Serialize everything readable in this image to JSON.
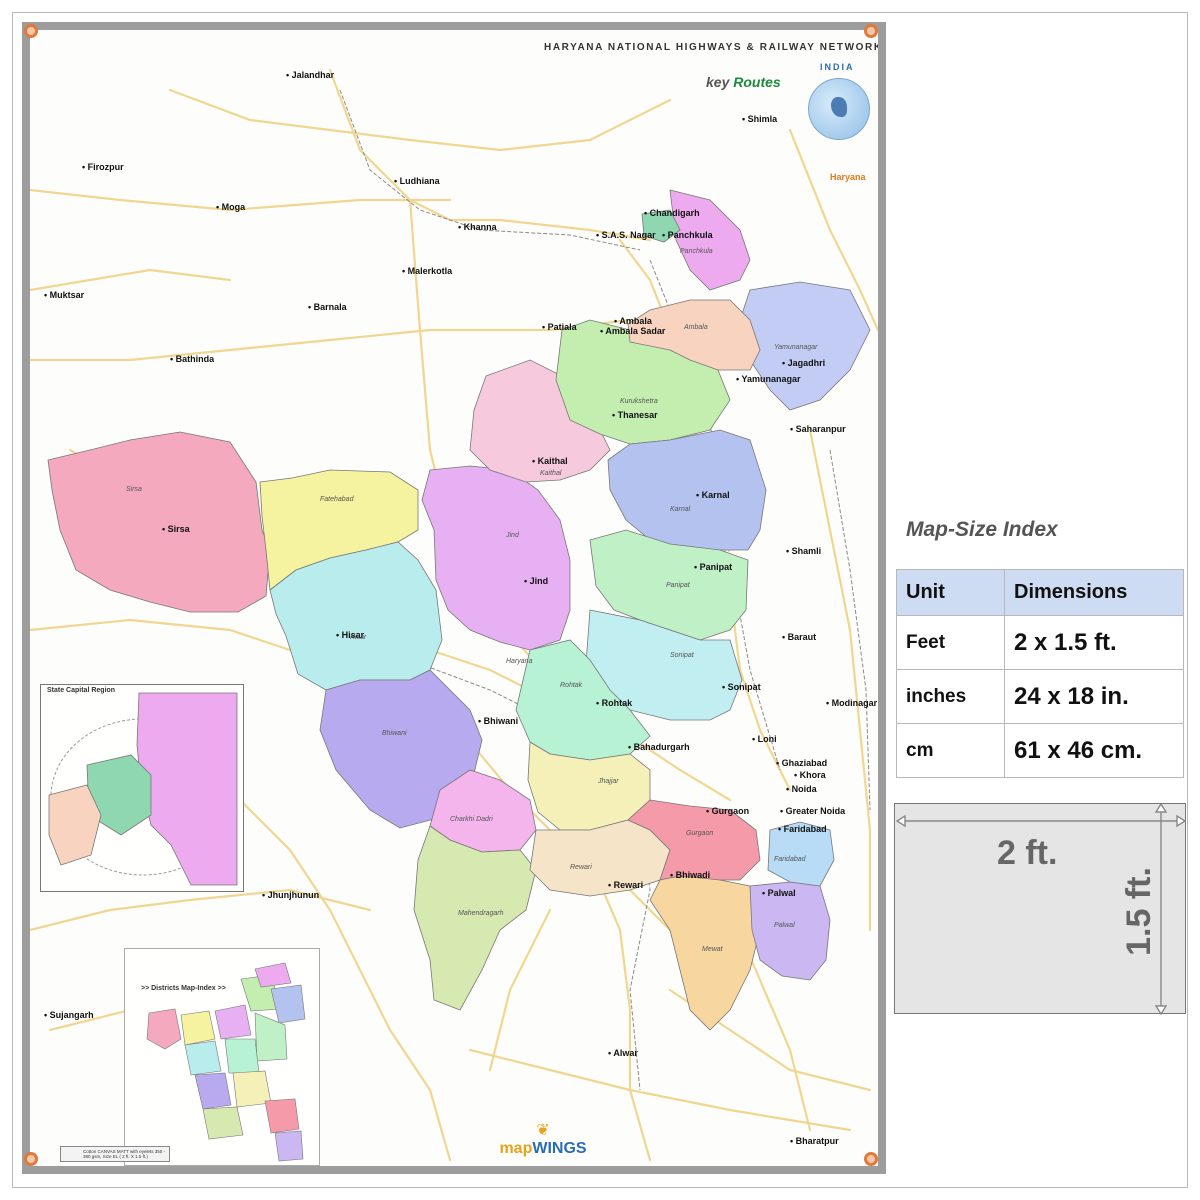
{
  "map": {
    "title": "HARYANA NATIONAL HIGHWAYS & RAILWAY NETWORK",
    "brand_key": "key",
    "brand_routes": "Routes",
    "country_label": "INDIA",
    "state_label": "Haryana",
    "inset_title": "State Capital Region",
    "districts_index_title": ">> Districts Map-Index >>",
    "publisher_prefix": "map",
    "publisher_suffix": "WINGS",
    "legend_note": "Cotton CANVAS MATT with eyelets 350 - 380 gsm, Size EL ( 2 ft. X 1.5 ft.)",
    "cities": [
      "Jalandhar",
      "Firozpur",
      "Moga",
      "Ludhiana",
      "Khanna",
      "Chandigarh",
      "S.A.S. Nagar",
      "Panchkula",
      "Shimla",
      "Muktsar",
      "Malerkotla",
      "Barnala",
      "Patiala",
      "Ambala",
      "Ambala Sadar",
      "Jagadhri",
      "Yamunanagar",
      "Bathinda",
      "Thanesar",
      "Saharanpur",
      "Kaithal",
      "Karnal",
      "Sirsa",
      "Shamli",
      "Jind",
      "Panipat",
      "Hisar",
      "Baraut",
      "Sonipat",
      "Rohtak",
      "Bhiwani",
      "Modinagar",
      "Bahadurgarh",
      "Loni",
      "Ghaziabad",
      "Khora",
      "Noida",
      "Greater Noida",
      "Faridabad",
      "Gurgaon",
      "Rewari",
      "Bhiwadi",
      "Palwal",
      "Jhunjhunun",
      "Sujangarh",
      "Alwar",
      "Bharatpur"
    ],
    "districts": [
      "Sirsa",
      "Fatehabad",
      "Hisar",
      "Bhiwani",
      "Charkhi Dadri",
      "Mahendragarh",
      "Jind",
      "Kaithal",
      "Kurukshetra",
      "Karnal",
      "Panipat",
      "Sonipat",
      "Rohtak",
      "Jhajjar",
      "Rewari",
      "Gurgaon",
      "Mewat",
      "Palwal",
      "Faridabad",
      "Yamunanagar",
      "Ambala",
      "Panchkula",
      "Haryana"
    ]
  },
  "size_index": {
    "title": "Map-Size Index",
    "headers": [
      "Unit",
      "Dimensions"
    ],
    "rows": [
      {
        "unit": "Feet",
        "dimension": "2 x 1.5 ft."
      },
      {
        "unit": "inches",
        "dimension": "24 x 18 in."
      },
      {
        "unit": "cm",
        "dimension": "61 x 46 cm."
      }
    ],
    "width_label": "2 ft.",
    "height_label": "1.5 ft."
  },
  "colors": {
    "sirsa": "#f4a9bf",
    "fatehabad": "#f5f3a0",
    "hisar": "#b9ecec",
    "bhiwani": "#b8aaee",
    "charkhi_dadri": "#f3b5ec",
    "mahendragarh": "#d6e9b0",
    "jind": "#e7b0f2",
    "kaithal": "#f7c9dd",
    "kurukshetra": "#c3eeb0",
    "karnal": "#b4c2f0",
    "panipat": "#bff0c6",
    "sonipat": "#c1eef0",
    "rohtak": "#b7f2d5",
    "jhajjar": "#f4f0b8",
    "rewari": "#f6e4c8",
    "gurgaon": "#f49aa8",
    "mewat": "#f7d6a0",
    "palwal": "#cbb7f2",
    "faridabad": "#b8dbf6",
    "yamunanagar": "#c3ccf4",
    "ambala": "#f7d3c0",
    "panchkula": "#eeaaee",
    "chandigarh": "#8fd7b0",
    "road": "#f0d690",
    "accent": "#e07a3c"
  }
}
